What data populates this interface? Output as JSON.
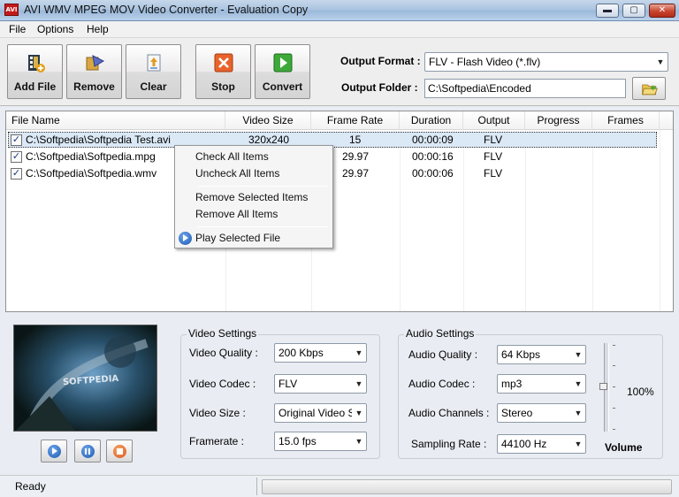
{
  "window": {
    "title": "AVI WMV MPEG MOV Video Converter - Evaluation Copy",
    "app_icon_text": "AVI",
    "minimize_glyph": "▬",
    "maximize_glyph": "▢",
    "close_glyph": "✕"
  },
  "menu": [
    "File",
    "Options",
    "Help"
  ],
  "toolbar": {
    "add_file": "Add File",
    "remove": "Remove",
    "clear": "Clear",
    "stop": "Stop",
    "convert": "Convert"
  },
  "output": {
    "format_label": "Output Format :",
    "format_value": "FLV - Flash Video (*.flv)",
    "folder_label": "Output Folder :",
    "folder_value": "C:\\Softpedia\\Encoded"
  },
  "file_list": {
    "columns": [
      "File Name",
      "Video Size",
      "Frame Rate",
      "Duration",
      "Output",
      "Progress",
      "Frames"
    ],
    "rows": [
      {
        "checked": "✓",
        "name": "C:\\Softpedia\\Softpedia Test.avi",
        "size": "320x240",
        "rate": "15",
        "duration": "00:00:09",
        "output": "FLV",
        "progress": "",
        "frames": ""
      },
      {
        "checked": "✓",
        "name": "C:\\Softpedia\\Softpedia.mpg",
        "size": "",
        "rate": "29.97",
        "duration": "00:00:16",
        "output": "FLV",
        "progress": "",
        "frames": ""
      },
      {
        "checked": "✓",
        "name": "C:\\Softpedia\\Softpedia.wmv",
        "size": "",
        "rate": "29.97",
        "duration": "00:00:06",
        "output": "FLV",
        "progress": "",
        "frames": ""
      }
    ],
    "selected_row": 0
  },
  "context_menu": {
    "check_all": "Check All Items",
    "uncheck_all": "Uncheck All Items",
    "remove_selected": "Remove Selected Items",
    "remove_all": "Remove All Items",
    "play_selected": "Play Selected File"
  },
  "preview": {
    "watermark": "SOFTPEDIA"
  },
  "video_settings": {
    "title": "Video Settings",
    "quality_label": "Video Quality :",
    "quality_value": "200 Kbps",
    "codec_label": "Video Codec :",
    "codec_value": "FLV",
    "size_label": "Video Size :",
    "size_value": "Original Video S",
    "framerate_label": "Framerate :",
    "framerate_value": "15.0 fps"
  },
  "audio_settings": {
    "title": "Audio Settings",
    "quality_label": "Audio  Quality :",
    "quality_value": "64 Kbps",
    "codec_label": "Audio Codec :",
    "codec_value": "mp3",
    "channels_label": "Audio Channels :",
    "channels_value": "Stereo",
    "sampling_label": "Sampling Rate :",
    "sampling_value": "44100 Hz"
  },
  "volume": {
    "label": "Volume",
    "value_text": "100%",
    "level": 1.0
  },
  "status": {
    "text": "Ready",
    "progress": 0
  },
  "colors": {
    "titlebar": "#a9c3e0",
    "selection": "#dbe8f6",
    "stop_icon": "#e8632b",
    "convert_icon": "#3ea93a",
    "media_button": "#1a56b0"
  }
}
